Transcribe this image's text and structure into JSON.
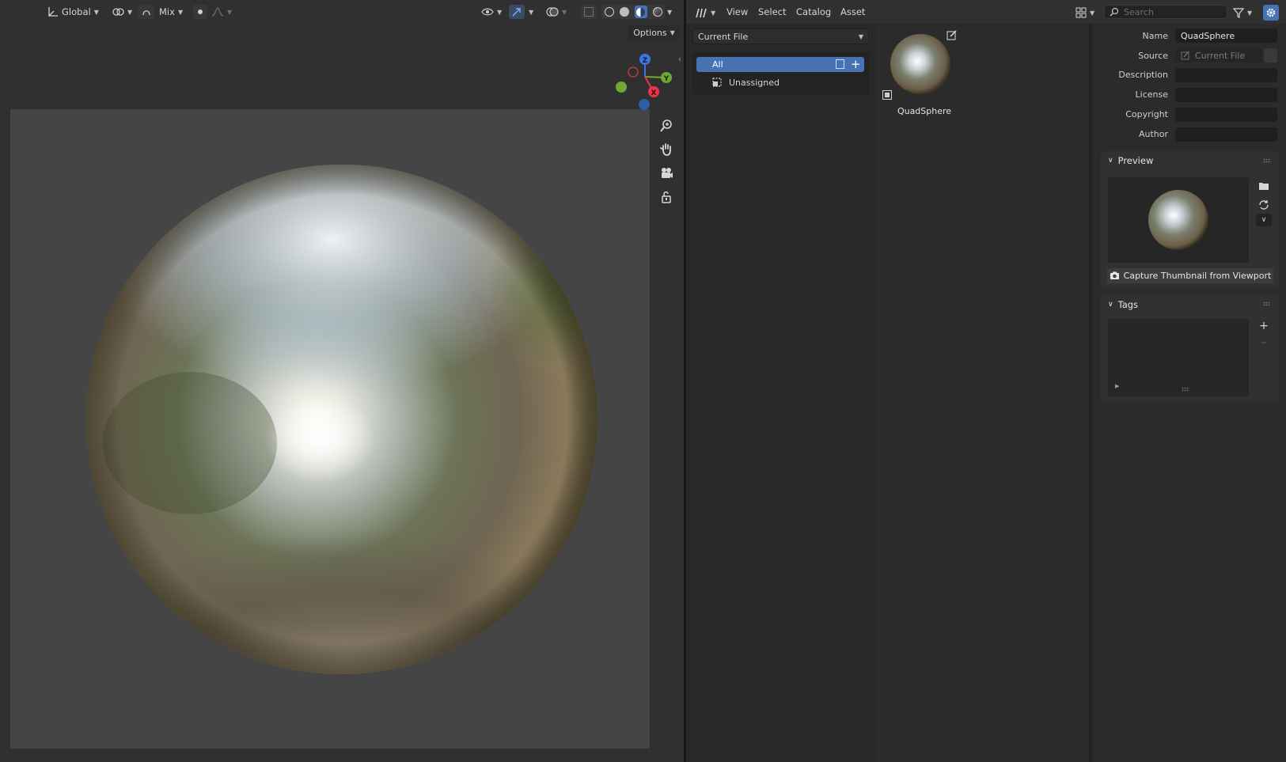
{
  "viewport": {
    "transform_orientation": "Global",
    "proportional_mode": "Mix",
    "options_label": "Options",
    "gizmo_labels": {
      "z": "Z",
      "y": "Y",
      "x": "X"
    },
    "sphere_object": "QuadSphere"
  },
  "asset_browser": {
    "menu": {
      "view": "View",
      "select": "Select",
      "catalog": "Catalog",
      "asset": "Asset"
    },
    "search_placeholder": "Search",
    "library_dropdown": "Current File",
    "catalog_tree": {
      "all": "All",
      "unassigned": "Unassigned"
    },
    "assets": [
      {
        "name": "QuadSphere"
      }
    ]
  },
  "sidebar": {
    "name_label": "Name",
    "name_value": "QuadSphere",
    "source_label": "Source",
    "source_value": "Current File",
    "description_label": "Description",
    "description_value": "",
    "license_label": "License",
    "license_value": "",
    "copyright_label": "Copyright",
    "copyright_value": "",
    "author_label": "Author",
    "author_value": "",
    "preview_title": "Preview",
    "capture_button": "Capture Thumbnail from Viewport",
    "tags_title": "Tags"
  },
  "colors": {
    "accent": "#4772b3",
    "axis_x": "#e8354a",
    "axis_y": "#6fa832",
    "axis_z": "#3b76e0",
    "viewport_bg": "#303030",
    "camera_frame": "#454545"
  }
}
